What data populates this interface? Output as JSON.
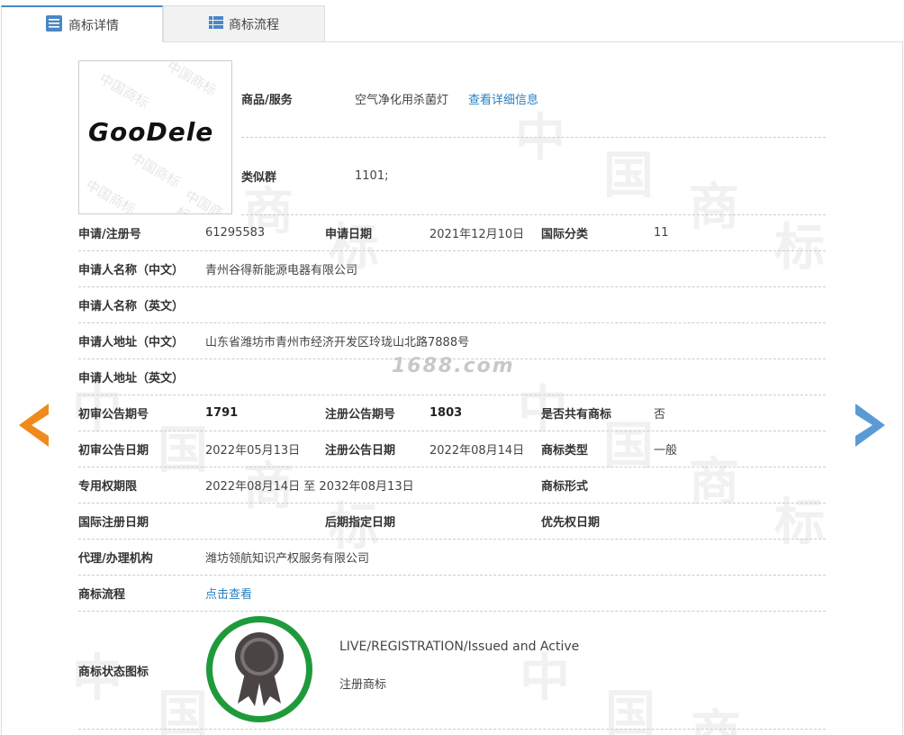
{
  "tabs": [
    {
      "label": "商标详情",
      "icon": "list-document-icon",
      "active": true
    },
    {
      "label": "商标流程",
      "icon": "list-icon",
      "active": false
    }
  ],
  "logo": {
    "text": "GooDele",
    "watermark": "中国商标"
  },
  "goods": {
    "label": "商品/服务",
    "value": "空气净化用杀菌灯",
    "link": "查看详细信息"
  },
  "similar_group": {
    "label": "类似群",
    "value": "1101;"
  },
  "fields": {
    "reg_no": {
      "label": "申请/注册号",
      "value": "61295583"
    },
    "apply_date": {
      "label": "申请日期",
      "value": "2021年12月10日"
    },
    "intl_class": {
      "label": "国际分类",
      "value": "11"
    },
    "applicant_cn": {
      "label": "申请人名称（中文）",
      "value": "青州谷得新能源电器有限公司"
    },
    "applicant_en": {
      "label": "申请人名称（英文）",
      "value": ""
    },
    "address_cn": {
      "label": "申请人地址（中文）",
      "value": "山东省潍坊市青州市经济开发区玲珑山北路7888号"
    },
    "address_en": {
      "label": "申请人地址（英文）",
      "value": ""
    },
    "prelim_issue": {
      "label": "初审公告期号",
      "value": "1791"
    },
    "reg_issue": {
      "label": "注册公告期号",
      "value": "1803"
    },
    "shared": {
      "label": "是否共有商标",
      "value": "否"
    },
    "prelim_date": {
      "label": "初审公告日期",
      "value": "2022年05月13日"
    },
    "reg_date": {
      "label": "注册公告日期",
      "value": "2022年08月14日"
    },
    "mark_type": {
      "label": "商标类型",
      "value": "一般"
    },
    "exclusive_period": {
      "label": "专用权期限",
      "value": "2022年08月14日 至 2032年08月13日"
    },
    "mark_form": {
      "label": "商标形式",
      "value": ""
    },
    "intl_reg_date": {
      "label": "国际注册日期",
      "value": ""
    },
    "later_designation": {
      "label": "后期指定日期",
      "value": ""
    },
    "priority_date": {
      "label": "优先权日期",
      "value": ""
    },
    "agent": {
      "label": "代理/办理机构",
      "value": "潍坊领航知识产权服务有限公司"
    },
    "flow": {
      "label": "商标流程",
      "link": "点击查看"
    },
    "status_icon": {
      "label": "商标状态图标",
      "status_en": "LIVE/REGISTRATION/Issued and Active",
      "status_cn": "注册商标"
    }
  },
  "watermark_site": "1688.com",
  "watermark_chars": [
    "中",
    "国",
    "商",
    "标"
  ],
  "colors": {
    "accent": "#4a86c5",
    "link": "#2a7fc0",
    "prev_arrow": "#f08a1c",
    "next_arrow": "#5b9bd5",
    "badge_ring": "#1f9a3a",
    "badge_medal": "#4a4444"
  }
}
